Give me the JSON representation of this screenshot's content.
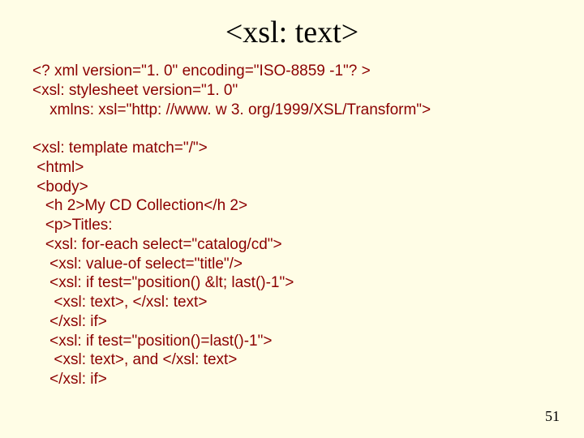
{
  "title": "<xsl: text>",
  "page_number": "51",
  "code_lines": [
    "<? xml version=\"1. 0\" encoding=\"ISO-8859 -1\"? >",
    "<xsl: stylesheet version=\"1. 0\"",
    "    xmlns: xsl=\"http: //www. w 3. org/1999/XSL/Transform\">",
    "",
    "<xsl: template match=\"/\">",
    " <html>",
    " <body>",
    "   <h 2>My CD Collection</h 2>",
    "   <p>Titles:",
    "   <xsl: for-each select=\"catalog/cd\">",
    "    <xsl: value-of select=\"title\"/>",
    "    <xsl: if test=\"position() &lt; last()-1\">",
    "     <xsl: text>, </xsl: text>",
    "    </xsl: if>",
    "    <xsl: if test=\"position()=last()-1\">",
    "     <xsl: text>, and </xsl: text>",
    "    </xsl: if>"
  ]
}
